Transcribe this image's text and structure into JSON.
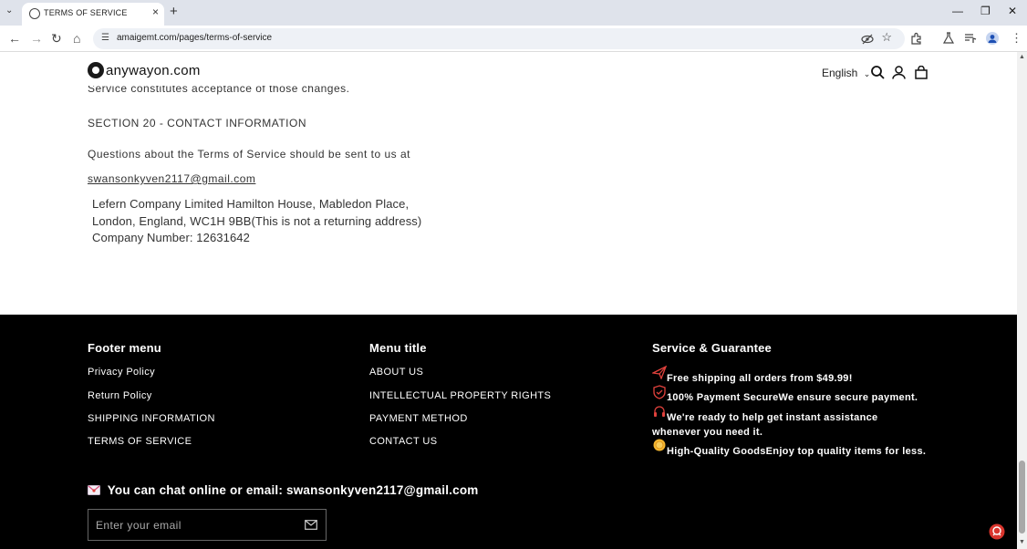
{
  "browser": {
    "tab_title": "TERMS OF SERVICE",
    "url": "amaigemt.com/pages/terms-of-service"
  },
  "header": {
    "logo_text": "anywayon.com",
    "language": "English"
  },
  "content": {
    "cut_line": "Service constitutes acceptance of those changes.",
    "section_title": "SECTION 20 - CONTACT INFORMATION",
    "questions_text": "Questions about the Terms of Service should be sent to us at",
    "email_link": "swansonkyven2117@gmail.com",
    "address_line1": "Lefern Company Limited Hamilton House, Mabledon Place,",
    "address_line2": "London, England, WC1H 9BB(This is not a returning address)",
    "company_number": "Company Number:   12631642"
  },
  "footer": {
    "menu1": {
      "title": "Footer menu",
      "items": [
        "Privacy Policy",
        "Return Policy",
        "SHIPPING INFORMATION",
        "TERMS OF SERVICE"
      ]
    },
    "menu2": {
      "title": "Menu title",
      "items": [
        "ABOUT US",
        "INTELLECTUAL PROPERTY RIGHTS",
        "PAYMENT METHOD",
        "CONTACT US"
      ]
    },
    "service": {
      "title": "Service & Guarantee",
      "items": [
        "Free shipping all orders from $49.99!",
        "100% Payment SecureWe ensure secure payment.",
        "We're ready to help get instant assistance whenever you need it.",
        "High-Quality GoodsEnjoy top quality items for less."
      ]
    },
    "contact_line": "You can chat online or email: swansonkyven2117@gmail.com",
    "email_placeholder": "Enter your email"
  }
}
